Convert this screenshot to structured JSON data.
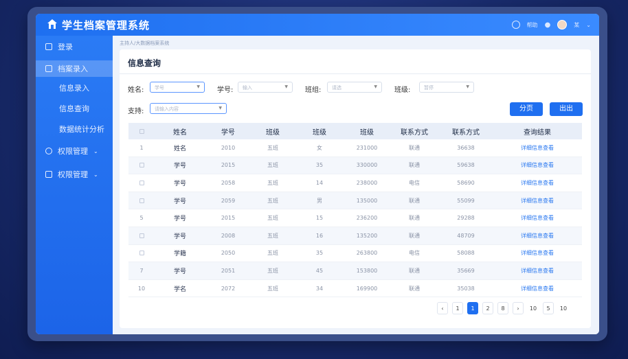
{
  "app": {
    "title": "学生档案管理系统"
  },
  "topbar": {
    "help": "帮助",
    "user": "某"
  },
  "sidebar": {
    "items": [
      {
        "label": "登录"
      },
      {
        "label": "档案录入"
      },
      {
        "label": "信息录入"
      },
      {
        "label": "信息查询"
      },
      {
        "label": "数据统计分析"
      },
      {
        "label": "权限管理"
      },
      {
        "label": "权限管理"
      }
    ]
  },
  "breadcrumb": "主持人/大数据档案系统",
  "card": {
    "title": "信息查询"
  },
  "filters": {
    "name_label": "姓名:",
    "name_placeholder": "学号",
    "id_label": "学号:",
    "id_placeholder": "输入",
    "class_label": "班组:",
    "class_placeholder": "请选",
    "group_label": "班级:",
    "group_placeholder": "暂停",
    "support_label": "支持:",
    "support_placeholder": "请输入内容"
  },
  "buttons": {
    "paginate": "分页",
    "export": "出出"
  },
  "table": {
    "headers": [
      "",
      "姓名",
      "学号",
      "班级",
      "班级",
      "班级",
      "联系方式",
      "联系方式",
      "查询结果"
    ],
    "rows": [
      [
        "1",
        "姓名",
        "2010",
        "五班",
        "女",
        "231000",
        "联通",
        "36638",
        "详细信息查看"
      ],
      [
        "",
        "学号",
        "2015",
        "五班",
        "35",
        "330000",
        "联通",
        "59638",
        "详细信息查看"
      ],
      [
        "",
        "学号",
        "2058",
        "五班",
        "14",
        "238000",
        "电信",
        "58690",
        "详细信息查看"
      ],
      [
        "",
        "学号",
        "2059",
        "五班",
        "男",
        "135000",
        "联通",
        "55099",
        "详细信息查看"
      ],
      [
        "5",
        "学号",
        "2015",
        "五班",
        "15",
        "236200",
        "联通",
        "29288",
        "详细信息查看"
      ],
      [
        "",
        "学号",
        "2008",
        "五班",
        "16",
        "135200",
        "联通",
        "48709",
        "详细信息查看"
      ],
      [
        "",
        "学籍",
        "2050",
        "五班",
        "35",
        "263800",
        "电信",
        "58088",
        "详细信息查看"
      ],
      [
        "7",
        "学号",
        "2051",
        "五班",
        "45",
        "153800",
        "联通",
        "35669",
        "详细信息查看"
      ],
      [
        "10",
        "学名",
        "2072",
        "五班",
        "34",
        "169900",
        "联通",
        "35038",
        "详细信息查看"
      ]
    ]
  },
  "pager": {
    "items": [
      "‹",
      "1",
      "1",
      "2",
      "8",
      "›",
      "10",
      "5",
      "10"
    ],
    "active": 2
  }
}
